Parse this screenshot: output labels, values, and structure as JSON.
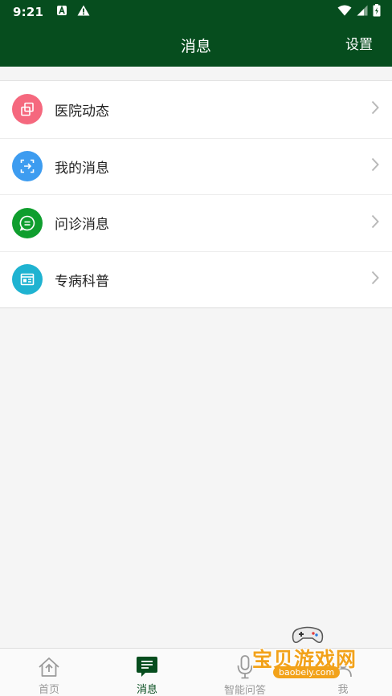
{
  "status_bar": {
    "time": "9:21",
    "left_icons": [
      "a-notification-icon",
      "warning-icon"
    ],
    "right_icons": [
      "wifi-icon",
      "signal-icon",
      "battery-icon"
    ]
  },
  "header": {
    "title": "消息",
    "settings_label": "设置",
    "background_color": "#064d1e"
  },
  "menu": {
    "items": [
      {
        "label": "医院动态",
        "icon": "hospital-news-icon",
        "color": "#f5687e"
      },
      {
        "label": "我的消息",
        "icon": "my-message-icon",
        "color": "#3d9cf0"
      },
      {
        "label": "问诊消息",
        "icon": "consultation-chat-icon",
        "color": "#0f9e2e"
      },
      {
        "label": "专病科普",
        "icon": "science-news-icon",
        "color": "#1fb3d1"
      }
    ]
  },
  "bottom_nav": {
    "items": [
      {
        "label": "首页",
        "icon": "home-icon",
        "active": false
      },
      {
        "label": "消息",
        "icon": "message-icon",
        "active": true
      },
      {
        "label": "智能问答",
        "icon": "microphone-icon",
        "active": false
      },
      {
        "label": "我",
        "icon": "user-icon",
        "active": false
      }
    ]
  },
  "watermark": {
    "text": "宝贝游戏网",
    "url": "baobeiy.com",
    "icon": "gamepad-icon"
  }
}
